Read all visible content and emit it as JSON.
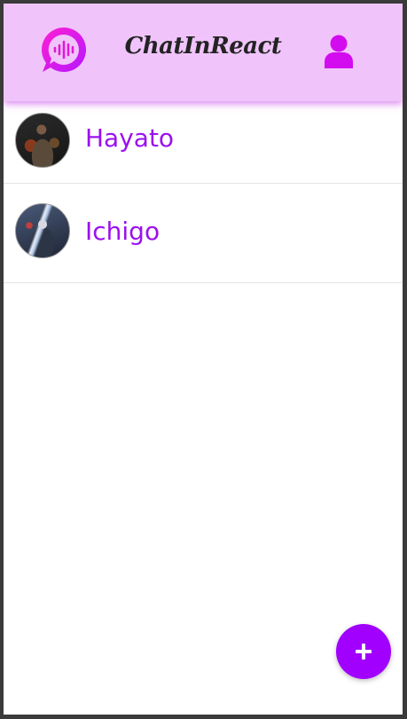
{
  "app": {
    "title": "ChatInReact"
  },
  "colors": {
    "header_bg": "#f0c4fa",
    "accent": "#a100ff",
    "name_text": "#9a10ef",
    "logo_gradient_start": "#ff1fd2",
    "logo_gradient_end": "#b517ff"
  },
  "header": {
    "logo_icon": "chat-bubble-soundwave-icon",
    "profile_icon": "user-icon"
  },
  "chats": [
    {
      "name": "Hayato",
      "avatar_icon": "avatar-photo"
    },
    {
      "name": "Ichigo",
      "avatar_icon": "avatar-photo"
    }
  ],
  "fab": {
    "icon": "plus-icon"
  }
}
